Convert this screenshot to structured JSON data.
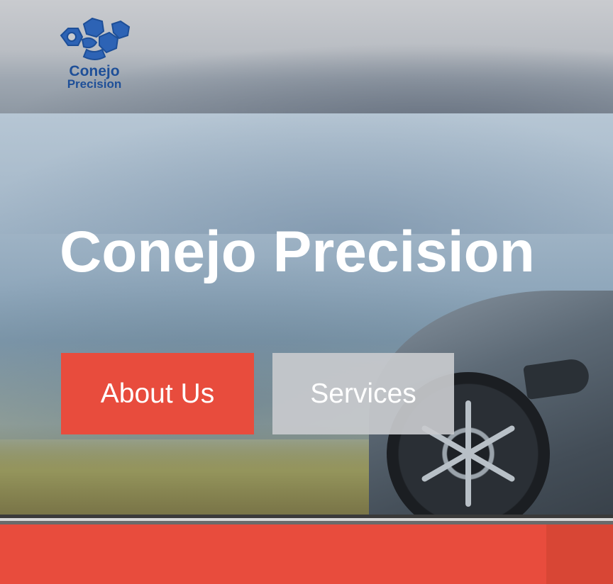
{
  "brand": {
    "logo_line1": "Conejo",
    "logo_line2": "Precision",
    "logo_color": "#1e4f98"
  },
  "hero": {
    "title": "Conejo Precision"
  },
  "buttons": {
    "about_label": "About Us",
    "services_label": "Services",
    "about_color": "#e84c3d",
    "services_color": "#c8cacd"
  },
  "footer_strip": {
    "color": "#e84c3d"
  }
}
